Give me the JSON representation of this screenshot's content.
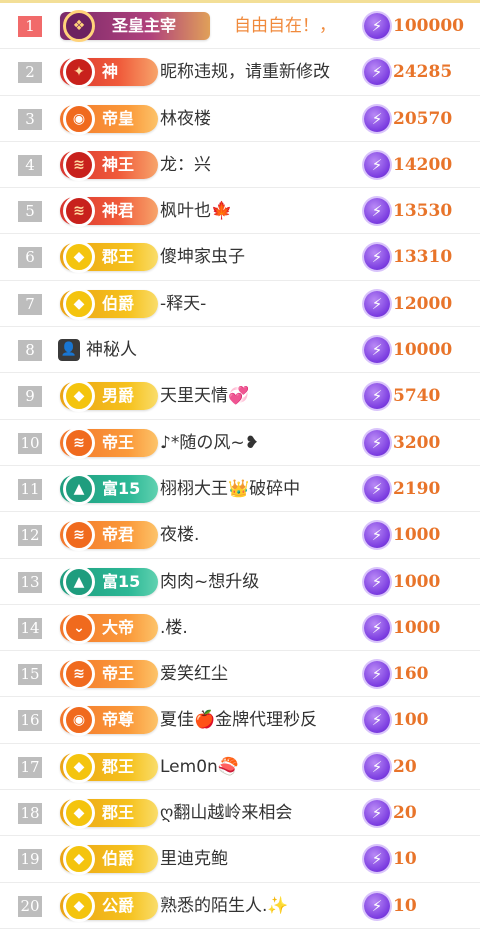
{
  "leaderboard": [
    {
      "rank": "1",
      "badge": "圣皇主宰",
      "badge_style": "royal",
      "emblem": "❖",
      "name": "自由自在！，",
      "name_color": "orange",
      "score": "100000"
    },
    {
      "rank": "2",
      "badge": "神",
      "badge_style": "red",
      "emblem": "✦",
      "name": "昵称违规，请重新修改",
      "score": "24285"
    },
    {
      "rank": "3",
      "badge": "帝皇",
      "badge_style": "orange",
      "emblem": "◉",
      "name": "林夜楼",
      "score": "20570"
    },
    {
      "rank": "4",
      "badge": "神王",
      "badge_style": "red",
      "emblem": "≋",
      "name": "龙：兴",
      "score": "14200"
    },
    {
      "rank": "5",
      "badge": "神君",
      "badge_style": "red",
      "emblem": "≋",
      "name": "枫叶也🍁",
      "score": "13530"
    },
    {
      "rank": "6",
      "badge": "郡王",
      "badge_style": "gold",
      "emblem": "◆",
      "name": "傻坤家虫子",
      "score": "13310"
    },
    {
      "rank": "7",
      "badge": "伯爵",
      "badge_style": "gold",
      "emblem": "◆",
      "name": "-释天-",
      "score": "12000"
    },
    {
      "rank": "8",
      "badge": "",
      "badge_style": "mystery",
      "emblem": "👤",
      "name": "神秘人",
      "score": "10000"
    },
    {
      "rank": "9",
      "badge": "男爵",
      "badge_style": "gold",
      "emblem": "◆",
      "name": "天里天情💞",
      "score": "5740"
    },
    {
      "rank": "10",
      "badge": "帝王",
      "badge_style": "orange",
      "emblem": "≋",
      "name": "♪*随の风~❥",
      "score": "3200"
    },
    {
      "rank": "11",
      "badge": "富15",
      "badge_style": "teal",
      "emblem": "▲",
      "name": "栩栩大王👑破碎中",
      "score": "2190"
    },
    {
      "rank": "12",
      "badge": "帝君",
      "badge_style": "orange",
      "emblem": "≋",
      "name": "夜楼.",
      "score": "1000"
    },
    {
      "rank": "13",
      "badge": "富15",
      "badge_style": "teal",
      "emblem": "▲",
      "name": "肉肉~想升级",
      "score": "1000"
    },
    {
      "rank": "14",
      "badge": "大帝",
      "badge_style": "orange",
      "emblem": "⌄",
      "name": ".楼.",
      "score": "1000"
    },
    {
      "rank": "15",
      "badge": "帝王",
      "badge_style": "orange",
      "emblem": "≋",
      "name": "爱笑红尘",
      "score": "160"
    },
    {
      "rank": "16",
      "badge": "帝尊",
      "badge_style": "orange",
      "emblem": "◉",
      "name": "夏佳🍎金牌代理秒反",
      "score": "100"
    },
    {
      "rank": "17",
      "badge": "郡王",
      "badge_style": "gold",
      "emblem": "◆",
      "name": "Lem0n🍣",
      "score": "20"
    },
    {
      "rank": "18",
      "badge": "郡王",
      "badge_style": "gold",
      "emblem": "◆",
      "name": "ღ翻山越岭来相会",
      "score": "20"
    },
    {
      "rank": "19",
      "badge": "伯爵",
      "badge_style": "gold",
      "emblem": "◆",
      "name": "里迪克鲍",
      "score": "10"
    },
    {
      "rank": "20",
      "badge": "公爵",
      "badge_style": "gold",
      "emblem": "◆",
      "name": "熟悉的陌生人.✨",
      "score": "10"
    }
  ],
  "coin_icon": "⚡",
  "colors": {
    "score": "#e8742a",
    "rank_top": "#f16a6a",
    "rank": "#bdbdbd"
  }
}
